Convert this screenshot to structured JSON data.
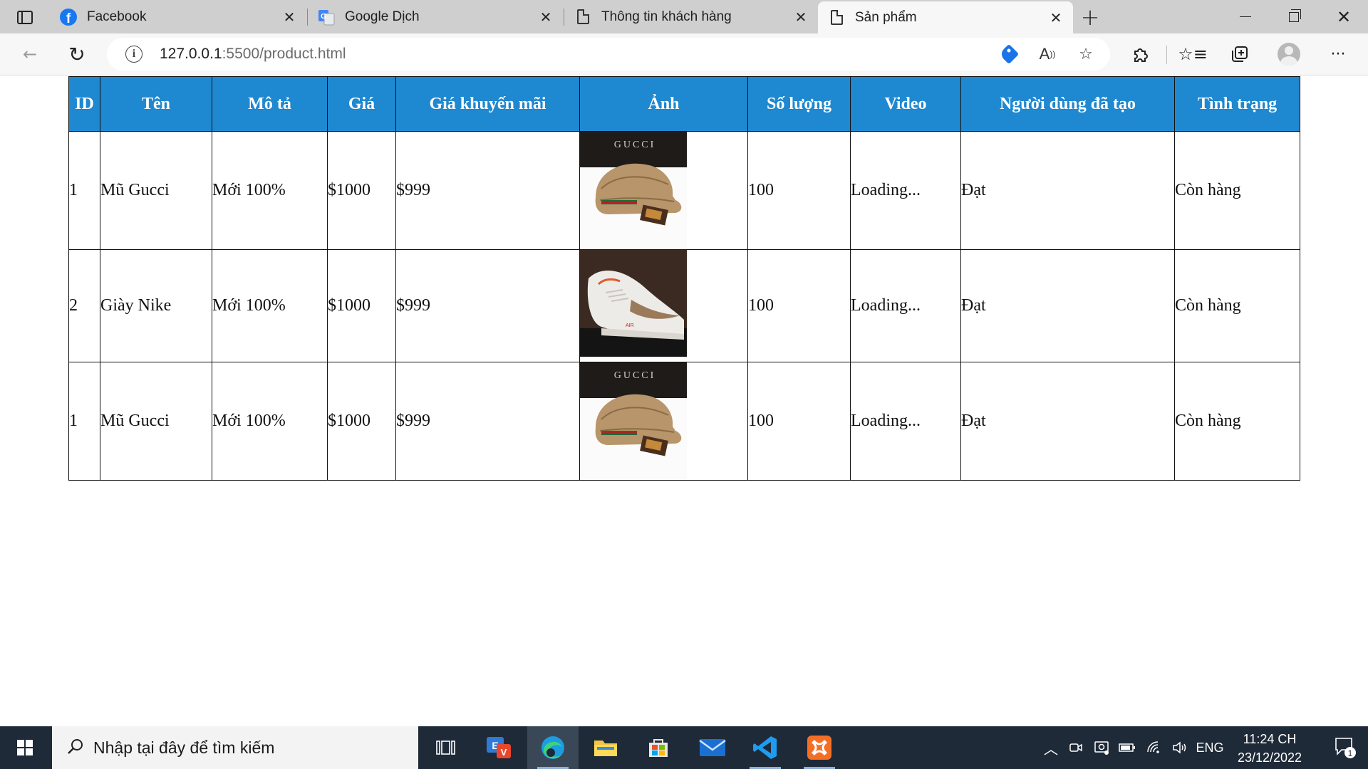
{
  "browser": {
    "tabs": [
      {
        "title": "Facebook",
        "icon": "facebook-icon"
      },
      {
        "title": "Google Dịch",
        "icon": "google-translate-icon"
      },
      {
        "title": "Thông tin khách hàng",
        "icon": "document-icon"
      },
      {
        "title": "Sản phẩm",
        "icon": "document-icon",
        "active": true
      }
    ],
    "url_host": "127.0.0.1",
    "url_path": ":5500/product.html"
  },
  "table": {
    "headers": [
      "ID",
      "Tên",
      "Mô tả",
      "Giá",
      "Giá khuyến mãi",
      "Ảnh",
      "Số lượng",
      "Video",
      "Người dùng đã tạo",
      "Tình trạng"
    ],
    "rows": [
      {
        "id": "1",
        "name": "Mũ Gucci",
        "desc": "Mới 100%",
        "price": "$1000",
        "sale": "$999",
        "image": "gucci-cap-image",
        "image_brand": "GUCCI",
        "qty": "100",
        "video": "Loading...",
        "creator": "Đạt",
        "status": "Còn hàng"
      },
      {
        "id": "2",
        "name": "Giày Nike",
        "desc": "Mới 100%",
        "price": "$1000",
        "sale": "$999",
        "image": "nike-shoe-image",
        "image_brand": "",
        "qty": "100",
        "video": "Loading...",
        "creator": "Đạt",
        "status": "Còn hàng"
      },
      {
        "id": "1",
        "name": "Mũ Gucci",
        "desc": "Mới 100%",
        "price": "$1000",
        "sale": "$999",
        "image": "gucci-cap-image",
        "image_brand": "GUCCI",
        "qty": "100",
        "video": "Loading...",
        "creator": "Đạt",
        "status": "Còn hàng"
      }
    ]
  },
  "taskbar": {
    "search_placeholder": "Nhập tại đây để tìm kiếm",
    "language": "ENG",
    "time": "11:24 CH",
    "date": "23/12/2022",
    "notification_count": "1"
  },
  "colors": {
    "header_bg": "#1e88d0",
    "taskbar_bg": "#1f2a38",
    "tabbar_bg": "#cfcfcf"
  }
}
